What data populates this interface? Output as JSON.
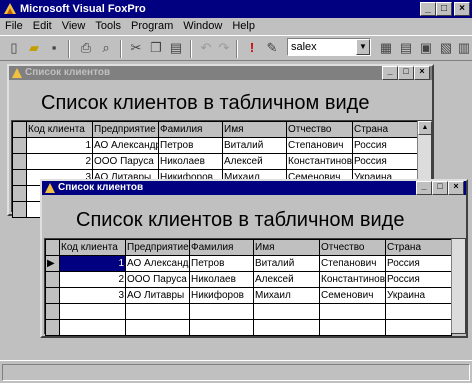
{
  "app": {
    "title": "Microsoft Visual FoxPro"
  },
  "menu": [
    "File",
    "Edit",
    "View",
    "Tools",
    "Program",
    "Window",
    "Help"
  ],
  "toolbar": {
    "combo_value": "salex",
    "icons": [
      "new-file-icon",
      "open-icon",
      "save-icon",
      "print-icon",
      "print-preview-icon",
      "spell-icon",
      "cut-icon",
      "copy-icon",
      "paste-icon",
      "undo-icon",
      "redo-icon",
      "run-icon",
      "modify-form-icon",
      "command-window-icon",
      "data-session-icon",
      "form-wizard-icon",
      "report-icon",
      "help-icon"
    ]
  },
  "window_back": {
    "title": "Список клиентов",
    "heading": "Список клиентов в табличном виде",
    "columns": [
      "Код клиента",
      "Предприятие",
      "Фамилия",
      "Имя",
      "Отчество",
      "Страна"
    ],
    "rows": [
      [
        "1",
        "АО Александр",
        "Петров",
        "Виталий",
        "Степанович",
        "Россия"
      ],
      [
        "2",
        "ООО Паруса",
        "Николаев",
        "Алексей",
        "Константинович",
        "Россия"
      ],
      [
        "3",
        "АО Литавры",
        "Никифоров",
        "Михаил",
        "Семенович",
        "Украина"
      ]
    ]
  },
  "window_front": {
    "title": "Список клиентов",
    "heading": "Список клиентов в табличном виде",
    "columns": [
      "Код клиента",
      "Предприятие",
      "Фамилия",
      "Имя",
      "Отчество",
      "Страна"
    ],
    "rows": [
      [
        "1",
        "АО Александр",
        "Петров",
        "Виталий",
        "Степанович",
        "Россия"
      ],
      [
        "2",
        "ООО Паруса",
        "Николаев",
        "Алексей",
        "Константинович",
        "Россия"
      ],
      [
        "3",
        "АО Литавры",
        "Никифоров",
        "Михаил",
        "Семенович",
        "Украина"
      ]
    ],
    "selected_row": 0
  },
  "colors": {
    "active_title": "#000080",
    "inactive_title": "#808080",
    "face": "#c0c0c0"
  }
}
